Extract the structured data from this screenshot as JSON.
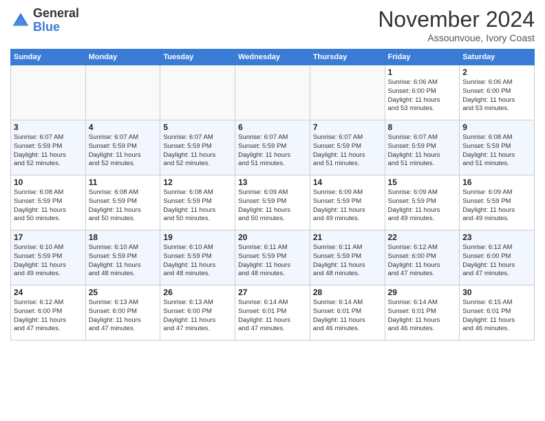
{
  "logo": {
    "general": "General",
    "blue": "Blue"
  },
  "header": {
    "month": "November 2024",
    "location": "Assounvoue, Ivory Coast"
  },
  "weekdays": [
    "Sunday",
    "Monday",
    "Tuesday",
    "Wednesday",
    "Thursday",
    "Friday",
    "Saturday"
  ],
  "weeks": [
    [
      {
        "day": "",
        "info": ""
      },
      {
        "day": "",
        "info": ""
      },
      {
        "day": "",
        "info": ""
      },
      {
        "day": "",
        "info": ""
      },
      {
        "day": "",
        "info": ""
      },
      {
        "day": "1",
        "info": "Sunrise: 6:06 AM\nSunset: 6:00 PM\nDaylight: 11 hours\nand 53 minutes."
      },
      {
        "day": "2",
        "info": "Sunrise: 6:06 AM\nSunset: 6:00 PM\nDaylight: 11 hours\nand 53 minutes."
      }
    ],
    [
      {
        "day": "3",
        "info": "Sunrise: 6:07 AM\nSunset: 5:59 PM\nDaylight: 11 hours\nand 52 minutes."
      },
      {
        "day": "4",
        "info": "Sunrise: 6:07 AM\nSunset: 5:59 PM\nDaylight: 11 hours\nand 52 minutes."
      },
      {
        "day": "5",
        "info": "Sunrise: 6:07 AM\nSunset: 5:59 PM\nDaylight: 11 hours\nand 52 minutes."
      },
      {
        "day": "6",
        "info": "Sunrise: 6:07 AM\nSunset: 5:59 PM\nDaylight: 11 hours\nand 51 minutes."
      },
      {
        "day": "7",
        "info": "Sunrise: 6:07 AM\nSunset: 5:59 PM\nDaylight: 11 hours\nand 51 minutes."
      },
      {
        "day": "8",
        "info": "Sunrise: 6:07 AM\nSunset: 5:59 PM\nDaylight: 11 hours\nand 51 minutes."
      },
      {
        "day": "9",
        "info": "Sunrise: 6:08 AM\nSunset: 5:59 PM\nDaylight: 11 hours\nand 51 minutes."
      }
    ],
    [
      {
        "day": "10",
        "info": "Sunrise: 6:08 AM\nSunset: 5:59 PM\nDaylight: 11 hours\nand 50 minutes."
      },
      {
        "day": "11",
        "info": "Sunrise: 6:08 AM\nSunset: 5:59 PM\nDaylight: 11 hours\nand 50 minutes."
      },
      {
        "day": "12",
        "info": "Sunrise: 6:08 AM\nSunset: 5:59 PM\nDaylight: 11 hours\nand 50 minutes."
      },
      {
        "day": "13",
        "info": "Sunrise: 6:09 AM\nSunset: 5:59 PM\nDaylight: 11 hours\nand 50 minutes."
      },
      {
        "day": "14",
        "info": "Sunrise: 6:09 AM\nSunset: 5:59 PM\nDaylight: 11 hours\nand 49 minutes."
      },
      {
        "day": "15",
        "info": "Sunrise: 6:09 AM\nSunset: 5:59 PM\nDaylight: 11 hours\nand 49 minutes."
      },
      {
        "day": "16",
        "info": "Sunrise: 6:09 AM\nSunset: 5:59 PM\nDaylight: 11 hours\nand 49 minutes."
      }
    ],
    [
      {
        "day": "17",
        "info": "Sunrise: 6:10 AM\nSunset: 5:59 PM\nDaylight: 11 hours\nand 49 minutes."
      },
      {
        "day": "18",
        "info": "Sunrise: 6:10 AM\nSunset: 5:59 PM\nDaylight: 11 hours\nand 48 minutes."
      },
      {
        "day": "19",
        "info": "Sunrise: 6:10 AM\nSunset: 5:59 PM\nDaylight: 11 hours\nand 48 minutes."
      },
      {
        "day": "20",
        "info": "Sunrise: 6:11 AM\nSunset: 5:59 PM\nDaylight: 11 hours\nand 48 minutes."
      },
      {
        "day": "21",
        "info": "Sunrise: 6:11 AM\nSunset: 5:59 PM\nDaylight: 11 hours\nand 48 minutes."
      },
      {
        "day": "22",
        "info": "Sunrise: 6:12 AM\nSunset: 6:00 PM\nDaylight: 11 hours\nand 47 minutes."
      },
      {
        "day": "23",
        "info": "Sunrise: 6:12 AM\nSunset: 6:00 PM\nDaylight: 11 hours\nand 47 minutes."
      }
    ],
    [
      {
        "day": "24",
        "info": "Sunrise: 6:12 AM\nSunset: 6:00 PM\nDaylight: 11 hours\nand 47 minutes."
      },
      {
        "day": "25",
        "info": "Sunrise: 6:13 AM\nSunset: 6:00 PM\nDaylight: 11 hours\nand 47 minutes."
      },
      {
        "day": "26",
        "info": "Sunrise: 6:13 AM\nSunset: 6:00 PM\nDaylight: 11 hours\nand 47 minutes."
      },
      {
        "day": "27",
        "info": "Sunrise: 6:14 AM\nSunset: 6:01 PM\nDaylight: 11 hours\nand 47 minutes."
      },
      {
        "day": "28",
        "info": "Sunrise: 6:14 AM\nSunset: 6:01 PM\nDaylight: 11 hours\nand 46 minutes."
      },
      {
        "day": "29",
        "info": "Sunrise: 6:14 AM\nSunset: 6:01 PM\nDaylight: 11 hours\nand 46 minutes."
      },
      {
        "day": "30",
        "info": "Sunrise: 6:15 AM\nSunset: 6:01 PM\nDaylight: 11 hours\nand 46 minutes."
      }
    ]
  ]
}
